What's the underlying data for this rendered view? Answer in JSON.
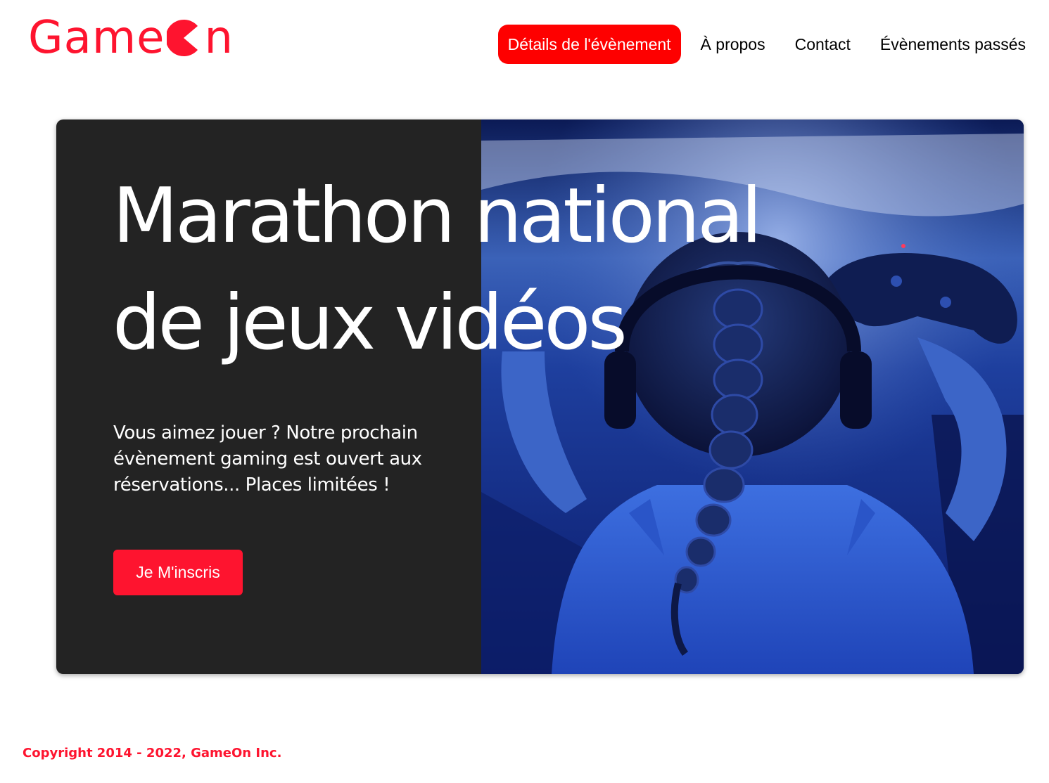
{
  "brand": {
    "logo_text_start": "Game",
    "logo_text_end": "n",
    "logo_icon": "pacman-o-icon",
    "accent_color": "#fe142f"
  },
  "nav": {
    "items": [
      {
        "label": "Détails de l'évènement",
        "active": true
      },
      {
        "label": "À propos",
        "active": false
      },
      {
        "label": "Contact",
        "active": false
      },
      {
        "label": "Évènements passés",
        "active": false
      }
    ]
  },
  "hero": {
    "title_line1": "Marathon national",
    "title_line2": "de jeux vidéos",
    "description": "Vous aimez jouer ? Notre prochain évènement gaming est ouvert aux réservations... Places limitées !",
    "cta_label": "Je M'inscris",
    "image": "gamer-girl-with-headphones-and-controller"
  },
  "footer": {
    "copyright": "Copyright 2014 - 2022, GameOn Inc."
  }
}
